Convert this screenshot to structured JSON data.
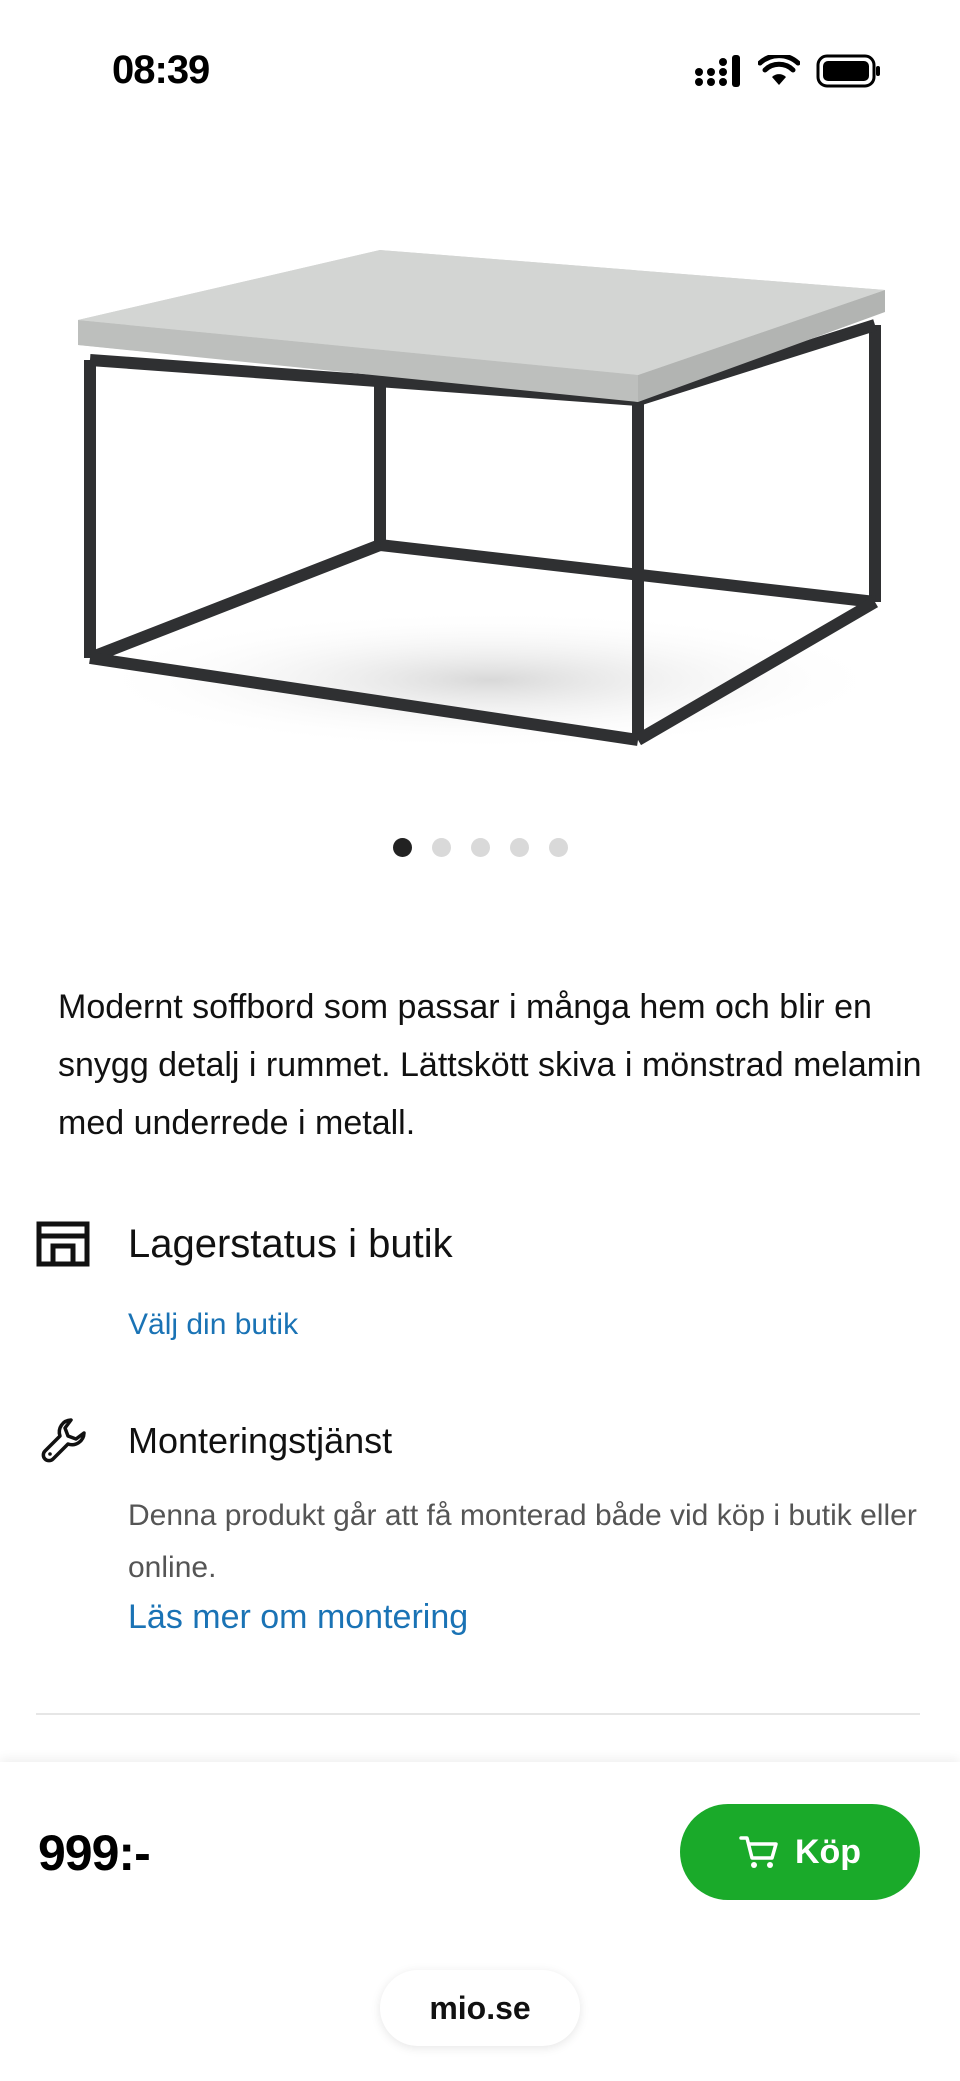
{
  "status_bar": {
    "time": "08:39",
    "icons": [
      "signal-icon",
      "wifi-icon",
      "battery-icon"
    ]
  },
  "product": {
    "image_alt_icon": "coffee-table-image",
    "carousel": {
      "total": 5,
      "active": 1
    },
    "description": "Modernt soffbord som passar i många hem och blir en snygg detalj i rummet. Lättskött skiva i mönstrad melamin med underrede i metall."
  },
  "stock": {
    "icon": "store-icon",
    "title": "Lagerstatus i butik",
    "link": "Välj din butik"
  },
  "assembly": {
    "icon": "wrench-icon",
    "title": "Monteringstjänst",
    "text": "Denna produkt går att få monterad både vid köp i butik eller online.",
    "link": "Läs mer om montering"
  },
  "buy_bar": {
    "price": "999:-",
    "button_label": "Köp",
    "button_icon": "cart-icon"
  },
  "browser": {
    "url": "mio.se"
  },
  "colors": {
    "link": "#1a73b5",
    "buy_button": "#1aaa2a"
  }
}
